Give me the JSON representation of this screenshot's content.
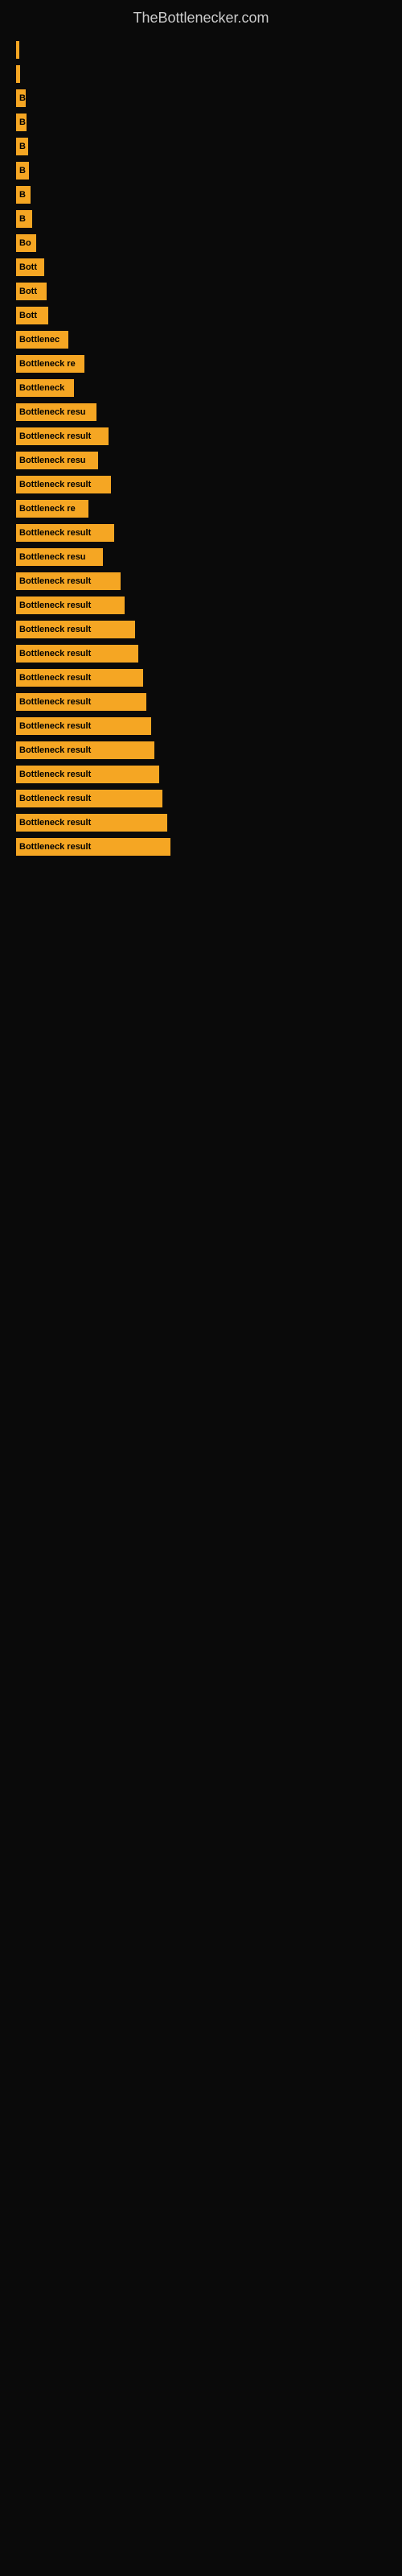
{
  "site": {
    "title": "TheBottlenecker.com"
  },
  "chart": {
    "bars": [
      {
        "id": 1,
        "label": "",
        "width": 4
      },
      {
        "id": 2,
        "label": "",
        "width": 5
      },
      {
        "id": 3,
        "label": "B",
        "width": 12
      },
      {
        "id": 4,
        "label": "B",
        "width": 13
      },
      {
        "id": 5,
        "label": "B",
        "width": 15
      },
      {
        "id": 6,
        "label": "B",
        "width": 16
      },
      {
        "id": 7,
        "label": "B",
        "width": 18
      },
      {
        "id": 8,
        "label": "B",
        "width": 20
      },
      {
        "id": 9,
        "label": "Bo",
        "width": 25
      },
      {
        "id": 10,
        "label": "Bott",
        "width": 35
      },
      {
        "id": 11,
        "label": "Bott",
        "width": 38
      },
      {
        "id": 12,
        "label": "Bott",
        "width": 40
      },
      {
        "id": 13,
        "label": "Bottlenec",
        "width": 65
      },
      {
        "id": 14,
        "label": "Bottleneck re",
        "width": 85
      },
      {
        "id": 15,
        "label": "Bottleneck",
        "width": 72
      },
      {
        "id": 16,
        "label": "Bottleneck resu",
        "width": 100
      },
      {
        "id": 17,
        "label": "Bottleneck result",
        "width": 115
      },
      {
        "id": 18,
        "label": "Bottleneck resu",
        "width": 102
      },
      {
        "id": 19,
        "label": "Bottleneck result",
        "width": 118
      },
      {
        "id": 20,
        "label": "Bottleneck re",
        "width": 90
      },
      {
        "id": 21,
        "label": "Bottleneck result",
        "width": 122
      },
      {
        "id": 22,
        "label": "Bottleneck resu",
        "width": 108
      },
      {
        "id": 23,
        "label": "Bottleneck result",
        "width": 130
      },
      {
        "id": 24,
        "label": "Bottleneck result",
        "width": 135
      },
      {
        "id": 25,
        "label": "Bottleneck result",
        "width": 148
      },
      {
        "id": 26,
        "label": "Bottleneck result",
        "width": 152
      },
      {
        "id": 27,
        "label": "Bottleneck result",
        "width": 158
      },
      {
        "id": 28,
        "label": "Bottleneck result",
        "width": 162
      },
      {
        "id": 29,
        "label": "Bottleneck result",
        "width": 168
      },
      {
        "id": 30,
        "label": "Bottleneck result",
        "width": 172
      },
      {
        "id": 31,
        "label": "Bottleneck result",
        "width": 178
      },
      {
        "id": 32,
        "label": "Bottleneck result",
        "width": 182
      },
      {
        "id": 33,
        "label": "Bottleneck result",
        "width": 188
      },
      {
        "id": 34,
        "label": "Bottleneck result",
        "width": 192
      }
    ]
  }
}
